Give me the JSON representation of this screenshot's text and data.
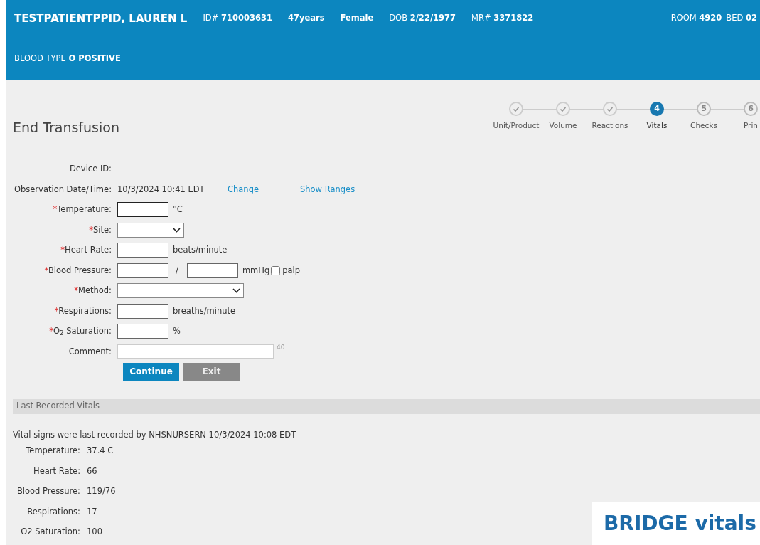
{
  "patient": {
    "name": "TESTPATIENTPPID, LAUREN L",
    "items": [
      {
        "prefix": "ID#",
        "value": "710003631"
      },
      {
        "value": "47years"
      },
      {
        "value": "Female"
      },
      {
        "prefix": "DOB",
        "value": "2/22/1977"
      },
      {
        "prefix": "MR#",
        "value": "3371822"
      }
    ],
    "location": [
      {
        "prefix": "ROOM",
        "value": "4920"
      },
      {
        "prefix": "BED",
        "value": "02"
      }
    ],
    "blood_type": {
      "prefix": "BLOOD TYPE",
      "value": "O POSITIVE"
    }
  },
  "page_title": "End Transfusion",
  "steps": [
    {
      "label": "Unit/Product",
      "done": true,
      "selected": false
    },
    {
      "label": "Volume",
      "done": true,
      "selected": false
    },
    {
      "label": "Reactions",
      "done": true,
      "selected": false
    },
    {
      "label": "Vitals",
      "number": "4",
      "done": false,
      "selected": true
    },
    {
      "label": "Checks",
      "number": "5",
      "done": false,
      "selected": false
    },
    {
      "label": "Prin",
      "number": "6",
      "done": false,
      "selected": false
    }
  ],
  "device_id_label": "Device ID:",
  "observation": {
    "label": "Observation Date/Time:",
    "value": "10/3/2024 10:41 EDT",
    "links": [
      "Change",
      "Show Ranges"
    ]
  },
  "fields": [
    {
      "kind": "text",
      "required_mark": "*",
      "label": "Temperature:",
      "unit": "°C",
      "focused": true
    },
    {
      "kind": "select",
      "required_mark": "*",
      "label": "Site:"
    },
    {
      "kind": "text",
      "required_mark": "*",
      "label": "Heart Rate:",
      "unit": "beats/minute",
      "focused": false
    },
    {
      "kind": "bp",
      "required_mark": "*",
      "label": "Blood Pressure:",
      "separator": "/",
      "unit": "mmHg",
      "checkbox_label": "palp",
      "checked": false
    },
    {
      "kind": "wideselect",
      "required_mark": "*",
      "label": "Method:"
    },
    {
      "kind": "text",
      "required_mark": "*",
      "label": "Respirations:",
      "unit": "breaths/minute",
      "focused": false
    },
    {
      "kind": "text",
      "required_mark": "*",
      "label": "O$_{2}$ Saturation:",
      "unit": "%",
      "focused": false
    },
    {
      "kind": "comment",
      "label": "Comment:",
      "counter": "40"
    }
  ],
  "buttons": [
    {
      "label": "Continue",
      "kind": "primary"
    },
    {
      "label": "Exit",
      "kind": "secondary"
    }
  ],
  "last_vitals": {
    "title": "Last Recorded Vitals",
    "summary": "Vital signs were last recorded by NHSNURSERN 10/3/2024 10:08 EDT",
    "rows": [
      {
        "label": "Temperature:",
        "value": "37.4 C"
      },
      {
        "label": "Heart Rate:",
        "value": "66"
      },
      {
        "label": "Blood Pressure:",
        "value": "119/76"
      },
      {
        "label": "Respirations:",
        "value": "17"
      },
      {
        "label": "O2 Saturation:",
        "value": "100"
      }
    ]
  },
  "logo": "BRIDGE vitals"
}
